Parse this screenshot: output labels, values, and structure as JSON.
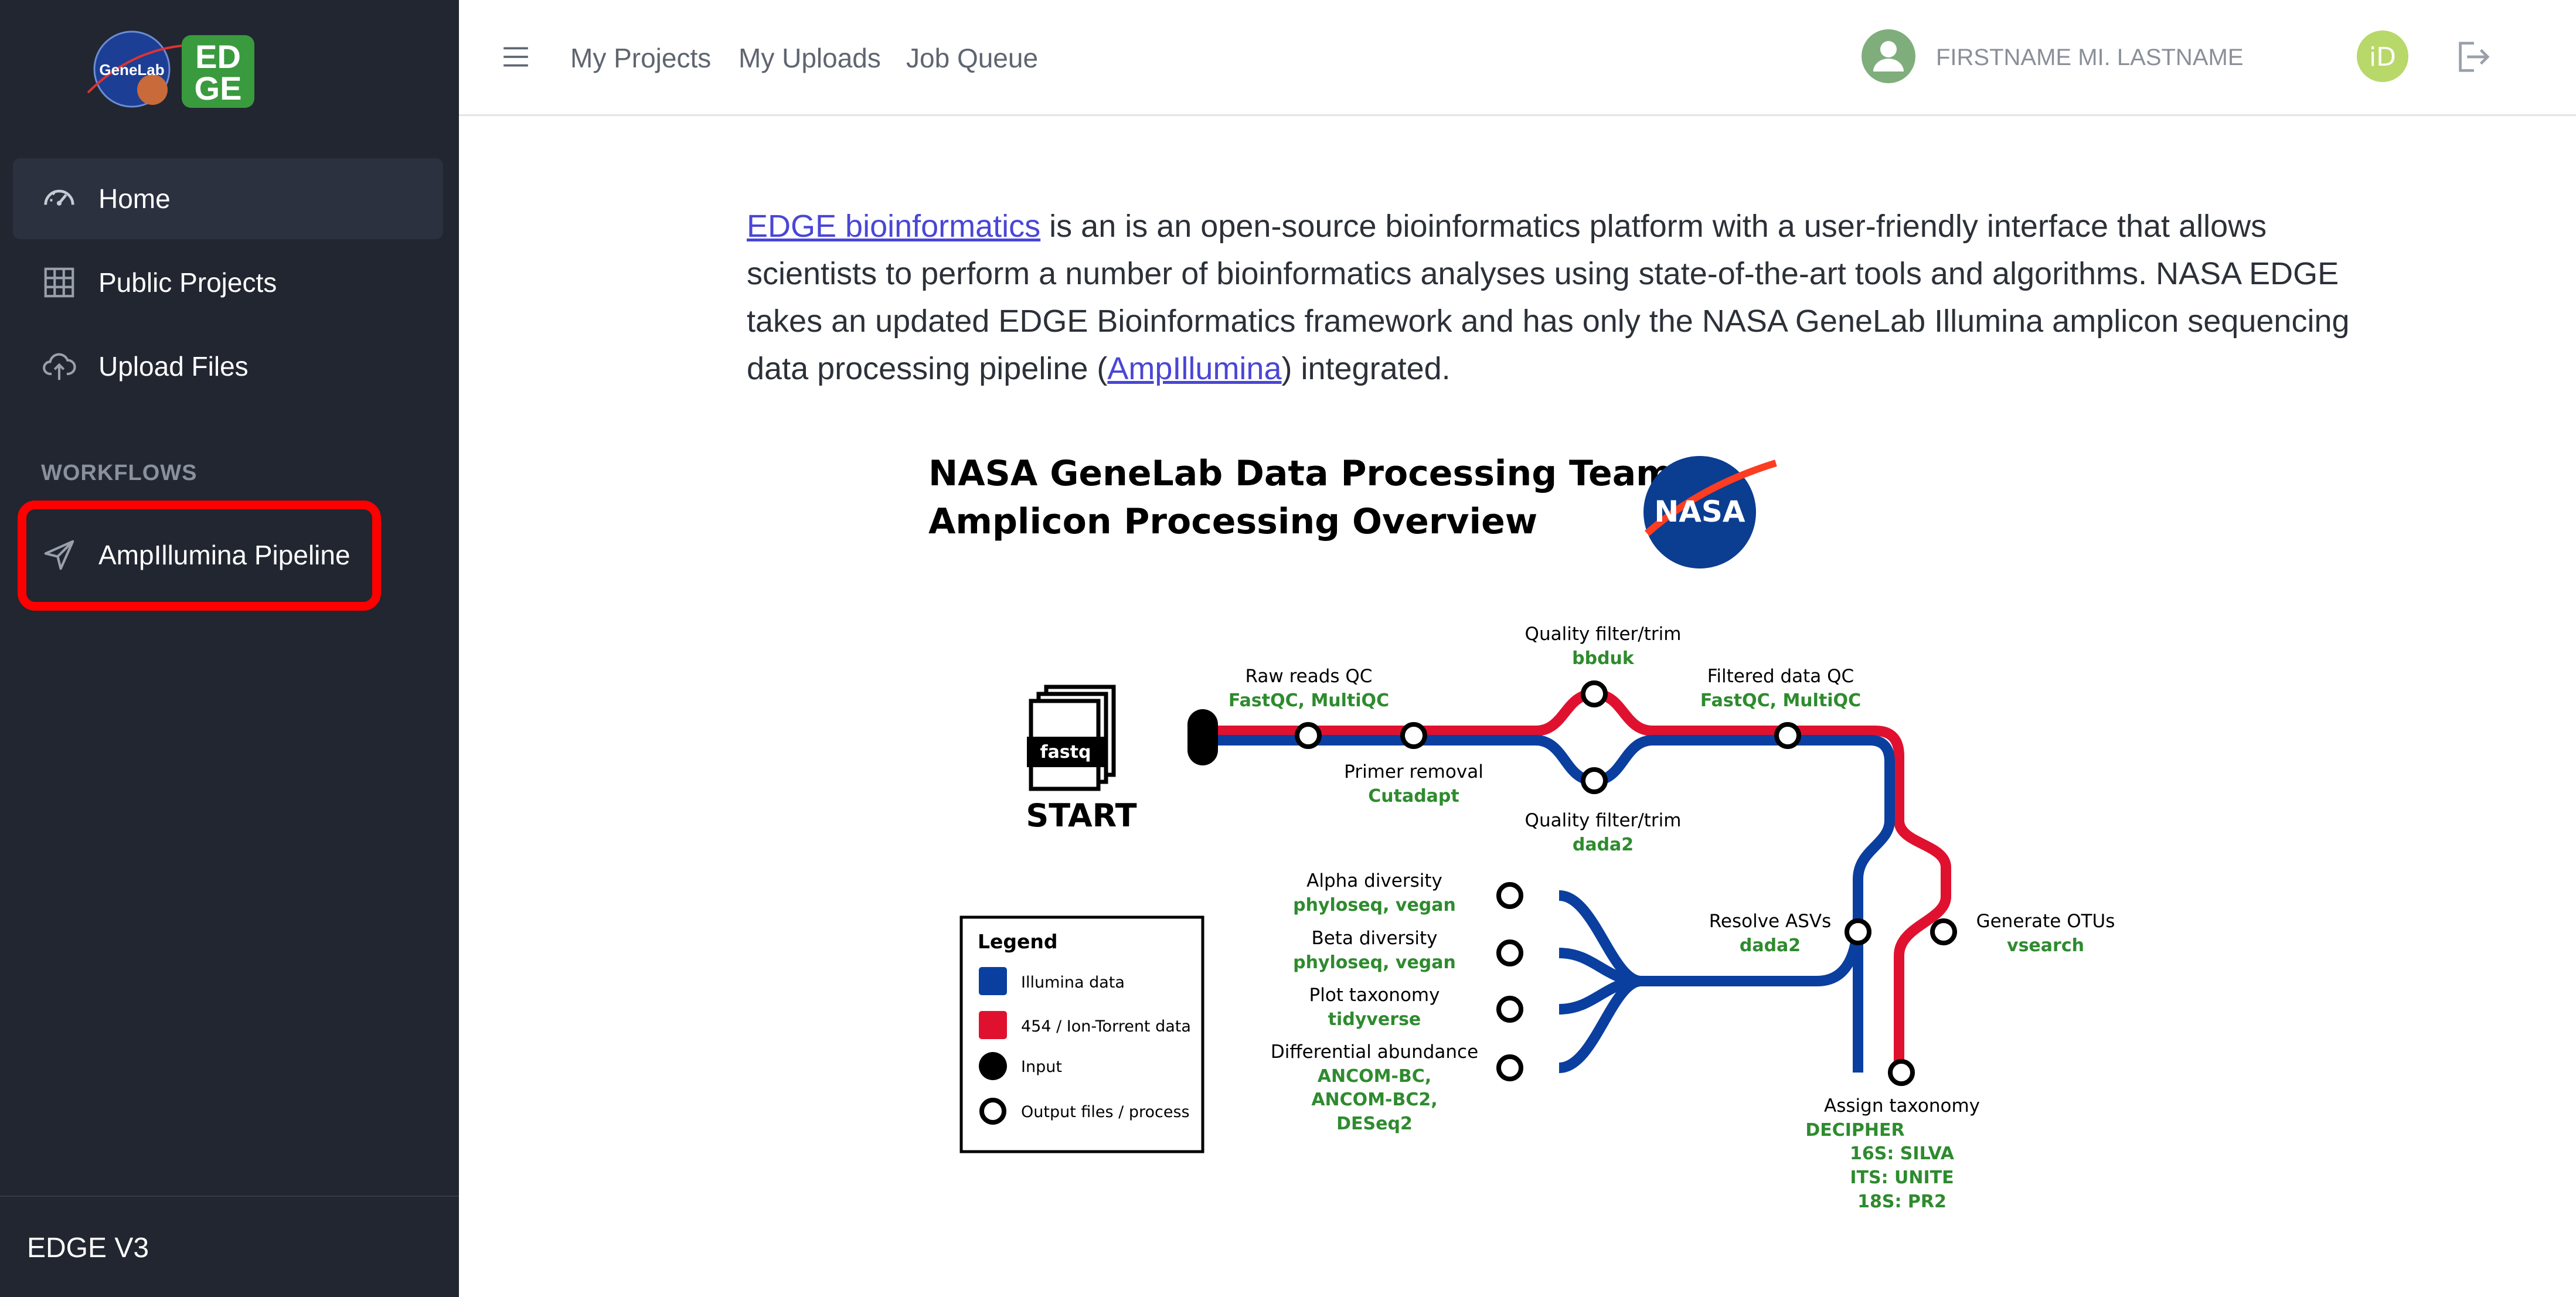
{
  "sidebar": {
    "logos": {
      "genelab": "GeneLab",
      "edge_top": "ED",
      "edge_bottom": "GE"
    },
    "items": [
      {
        "label": "Home",
        "icon": "dashboard-gauge-icon"
      },
      {
        "label": "Public Projects",
        "icon": "grid-icon"
      },
      {
        "label": "Upload Files",
        "icon": "cloud-upload-icon"
      }
    ],
    "workflows_title": "WORKFLOWS",
    "workflows": [
      {
        "label": "AmpIllumina Pipeline",
        "icon": "send-icon"
      }
    ],
    "version": "EDGE V3"
  },
  "header": {
    "links": [
      "My Projects",
      "My Uploads",
      "Job Queue"
    ],
    "user_name": "FIRSTNAME MI. LASTNAME",
    "orcid": "iD"
  },
  "intro": {
    "link1": "EDGE bioinformatics",
    "text1": " is an is an open-source bioinformatics platform with a user-friendly interface that allows scientists to perform a number of bioinformatics analyses using state-of-the-art tools and algorithms. NASA EDGE takes an updated EDGE Bioinformatics framework and has only the NASA GeneLab Illumina amplicon sequencing data processing pipeline (",
    "link2": "AmpIllumina",
    "text2": ") integrated."
  },
  "diagram": {
    "title_line1": "NASA GeneLab Data Processing Team",
    "title_line2": "Amplicon Processing Overview",
    "nasa_logo": "NASA",
    "start_file": "fastq",
    "start_label": "START",
    "colors": {
      "illumina": "#0a3fa0",
      "ion": "#e0112f",
      "tool": "#2e8b2e"
    },
    "steps": {
      "raw_qc": {
        "label": "Raw reads QC",
        "tools": "FastQC, MultiQC"
      },
      "primer": {
        "label": "Primer removal",
        "tools": "Cutadapt"
      },
      "qf_top": {
        "label": "Quality filter/trim",
        "tools": "bbduk"
      },
      "qf_bottom": {
        "label": "Quality filter/trim",
        "tools": "dada2"
      },
      "filtered_qc": {
        "label": "Filtered data QC",
        "tools": "FastQC, MultiQC"
      },
      "resolve": {
        "label": "Resolve ASVs",
        "tools": "dada2"
      },
      "otus": {
        "label": "Generate OTUs",
        "tools": "vsearch"
      },
      "assign": {
        "label": "Assign taxonomy",
        "tools": "DECIPHER",
        "db1": "16S: SILVA",
        "db2": "ITS: UNITE",
        "db3": "18S: PR2"
      },
      "alpha": {
        "label": "Alpha diversity",
        "tools": "phyloseq, vegan"
      },
      "beta": {
        "label": "Beta diversity",
        "tools": "phyloseq, vegan"
      },
      "plot": {
        "label": "Plot taxonomy",
        "tools": "tidyverse"
      },
      "diff": {
        "label": "Differential abundance",
        "tools1": "ANCOM-BC,",
        "tools2": "ANCOM-BC2,",
        "tools3": "DESeq2"
      }
    },
    "legend": {
      "title": "Legend",
      "illumina": "Illumina data",
      "ion": "454 / Ion-Torrent data",
      "input": "Input",
      "output": "Output files / process"
    }
  }
}
